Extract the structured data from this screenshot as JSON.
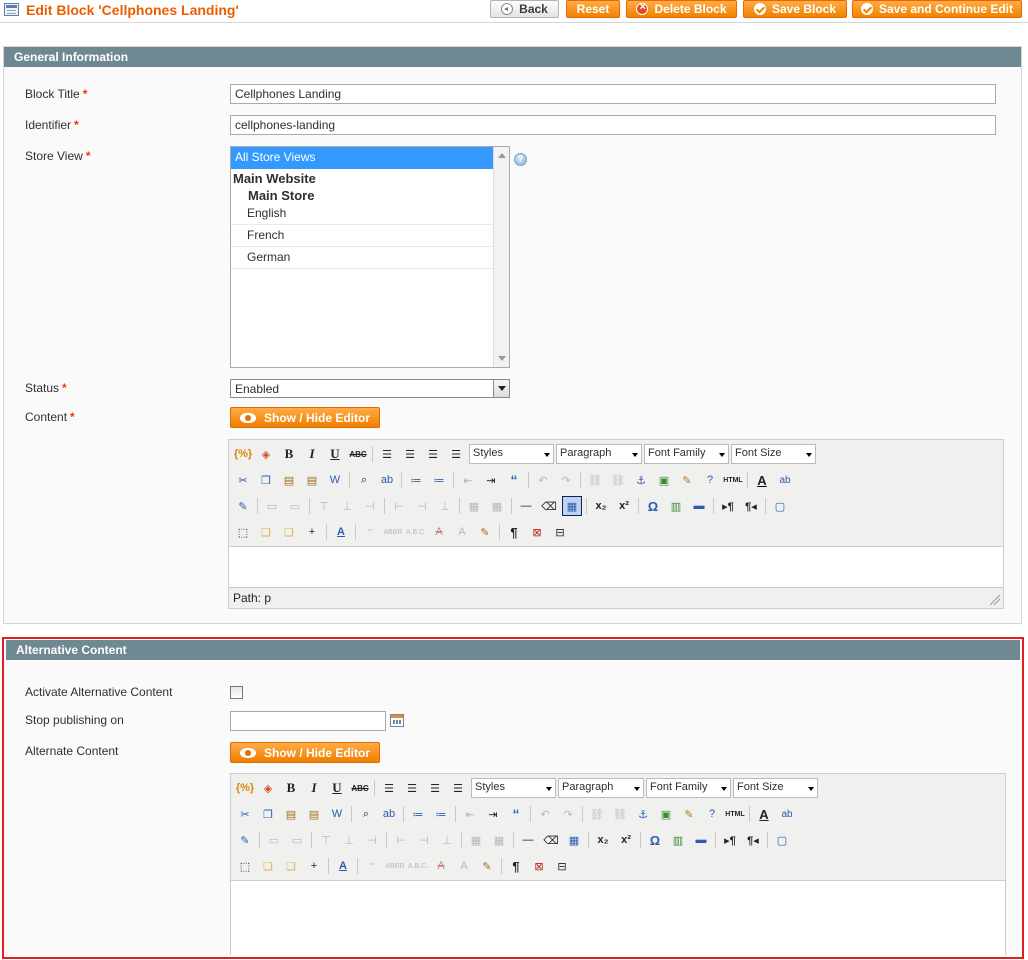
{
  "page": {
    "title": "Edit Block 'Cellphones Landing'"
  },
  "actions": {
    "back": "Back",
    "reset": "Reset",
    "delete": "Delete Block",
    "save": "Save Block",
    "save_continue": "Save and Continue Edit"
  },
  "general": {
    "heading": "General Information",
    "block_title_label": "Block Title",
    "block_title_value": "Cellphones Landing",
    "identifier_label": "Identifier",
    "identifier_value": "cellphones-landing",
    "store_view_label": "Store View",
    "store_options": {
      "all": "All Store Views",
      "website": "Main Website",
      "store": "Main Store",
      "views": [
        "English",
        "French",
        "German"
      ]
    },
    "status_label": "Status",
    "status_value": "Enabled",
    "content_label": "Content",
    "toggle_editor": "Show / Hide Editor",
    "path_text": "Path: p"
  },
  "editor": {
    "styles": "Styles",
    "paragraph": "Paragraph",
    "font_family": "Font Family",
    "font_size": "Font Size"
  },
  "alternative": {
    "heading": "Alternative Content",
    "activate_label": "Activate Alternative Content",
    "stop_label": "Stop publishing on",
    "stop_value": "",
    "alt_content_label": "Alternate Content",
    "toggle_editor": "Show / Hide Editor"
  },
  "required_mark": "*",
  "colors": {
    "accent": "#eb5e00",
    "section_header": "#6f8992",
    "highlight": "#e02020"
  }
}
